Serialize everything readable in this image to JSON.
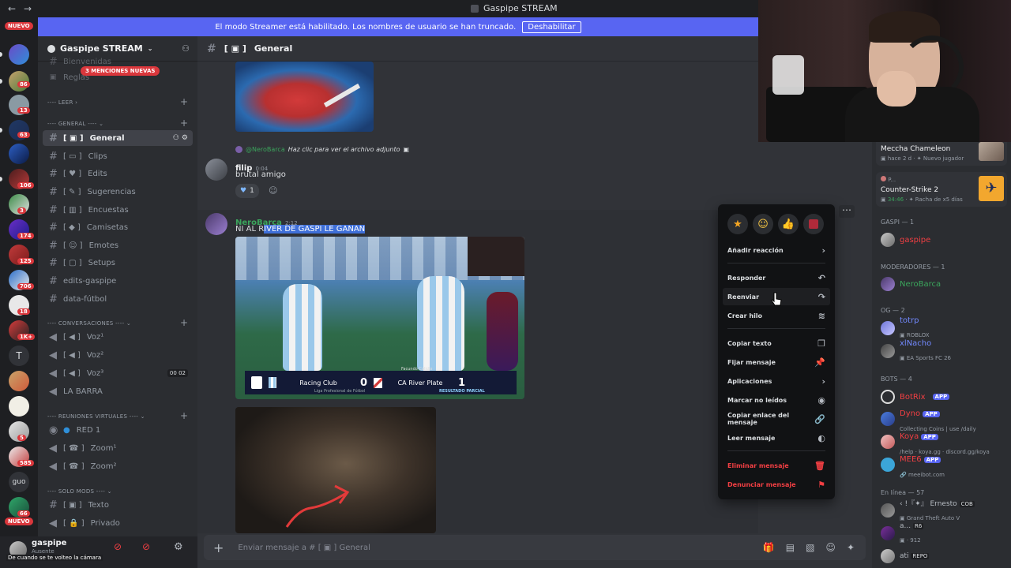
{
  "window": {
    "title": "Gaspipe STREAM",
    "back": "←",
    "forward": "→"
  },
  "banner": {
    "text": "El modo Streamer está habilitado. Los nombres de usuario se han truncado.",
    "button": "Deshabilitar"
  },
  "rail": {
    "new_top": "NUEVO",
    "new_bottom": "NUEVO",
    "badges": [
      "86",
      "13",
      "63",
      "106",
      "3",
      "174",
      "125",
      "706",
      "18",
      "1K+",
      "5",
      "585",
      "66"
    ],
    "letter_t": "T",
    "letters_guo": "guo"
  },
  "server": {
    "name": "Gaspipe STREAM",
    "mentions": "3 MENCIONES NUEVAS"
  },
  "categories": {
    "leer": "LEER",
    "general": "GENERAL",
    "conversaciones": "CONVERSACIONES",
    "reuniones": "REUNIONES VIRTUALES",
    "solomods": "SOLO MODS"
  },
  "channels": {
    "hidden1": "Bienvenidas",
    "hidden2": "Reglas",
    "general": "General",
    "clips": "Clips",
    "edits": "Edits",
    "sugerencias": "Sugerencias",
    "encuestas": "Encuestas",
    "camisetas": "Camisetas",
    "emotes": "Emotes",
    "setups": "Setups",
    "edits_gaspipe": "edits-gaspipe",
    "data_futbol": "data-fútbol",
    "voz1": "Voz¹",
    "voz2": "Voz²",
    "voz3": "Voz³",
    "voz3_count_a": "00",
    "voz3_count_b": "02",
    "la_barra": "LA BARRA",
    "red1": "RED 1",
    "zoom1": "Zoom¹",
    "zoom2": "Zoom²",
    "texto": "Texto",
    "privado": "Privado"
  },
  "user": {
    "name": "gaspipe",
    "status": "Ausente",
    "caption": "De cuando se te volteo la cámara"
  },
  "chat": {
    "channel": "General",
    "reply_to": "@NeroBarca",
    "reply_text": "Haz clic para ver el archivo adjunto",
    "msg1": {
      "author": "filip",
      "time": "0:04",
      "text": "brutal amigo",
      "reaction_count": "1"
    },
    "msg2": {
      "author": "NeroBarca",
      "time": "2:12",
      "text_pre": "NI AL R",
      "text_sel": "IVER DE GASPI LE GANAN"
    },
    "score": {
      "home": "Racing Club",
      "home_goals": "0",
      "away": "CA River Plate",
      "away_goals": "1",
      "league": "Liga Profesional de Fútbol",
      "status": "RESULTADO PARCIAL",
      "player": "Facundo Colidio"
    },
    "composer_placeholder": "Enviar mensaje a #",
    "composer_channel": "General"
  },
  "context_menu": {
    "add_reaction": "Añadir reacción",
    "reply": "Responder",
    "forward": "Reenviar",
    "thread": "Crear hilo",
    "copy_text": "Copiar texto",
    "pin": "Fijar mensaje",
    "apps": "Aplicaciones",
    "mark_unread": "Marcar no leídos",
    "copy_link": "Copiar enlace del mensaje",
    "read": "Leer mensaje",
    "delete": "Eliminar mensaje",
    "report": "Denunciar mensaje"
  },
  "members": {
    "activity1": {
      "name": "Meccha Chameleon",
      "sub1": "hace 2 d",
      "sub2": "Nuevo jugador"
    },
    "activity2": {
      "pre": "P...",
      "name": "Counter-Strike 2",
      "time": "34:46",
      "sub": "Racha de x5 días"
    },
    "gaspi_cat": "GASPI — 1",
    "gaspi": "gaspipe",
    "mods_cat": "MODERADORES — 1",
    "nero": "NeroBarca",
    "og_cat": "OG — 2",
    "totrp": "totrp",
    "totrp_sub": "ROBLOX",
    "xlnacho": "xlNacho",
    "xlnacho_sub": "EA Sports FC 26",
    "bots_cat": "BOTS — 4",
    "botrix": "BotRix",
    "dyno": "Dyno",
    "dyno_sub": "Collecting Coins | use /daily",
    "koya": "Koya",
    "koya_sub": "/help · koya.gg · discord.gg/koya",
    "mee6": "MEE6",
    "mee6_sub": "meeibot.com",
    "app_label": "APP",
    "online_cat": "En línea — 57",
    "ernesto": "Ernesto",
    "ernesto_tag": "COB",
    "ernesto_sub": "Grand Theft Auto V",
    "a_name": "a...",
    "a_tag": "R6",
    "a_sub": "912",
    "ati": "ati",
    "ati_tag": "REPO"
  },
  "colors": {
    "brand": "#5865f2",
    "danger": "#f23f43",
    "mod_green": "#3ba55c",
    "bot_red": "#f23f43"
  }
}
